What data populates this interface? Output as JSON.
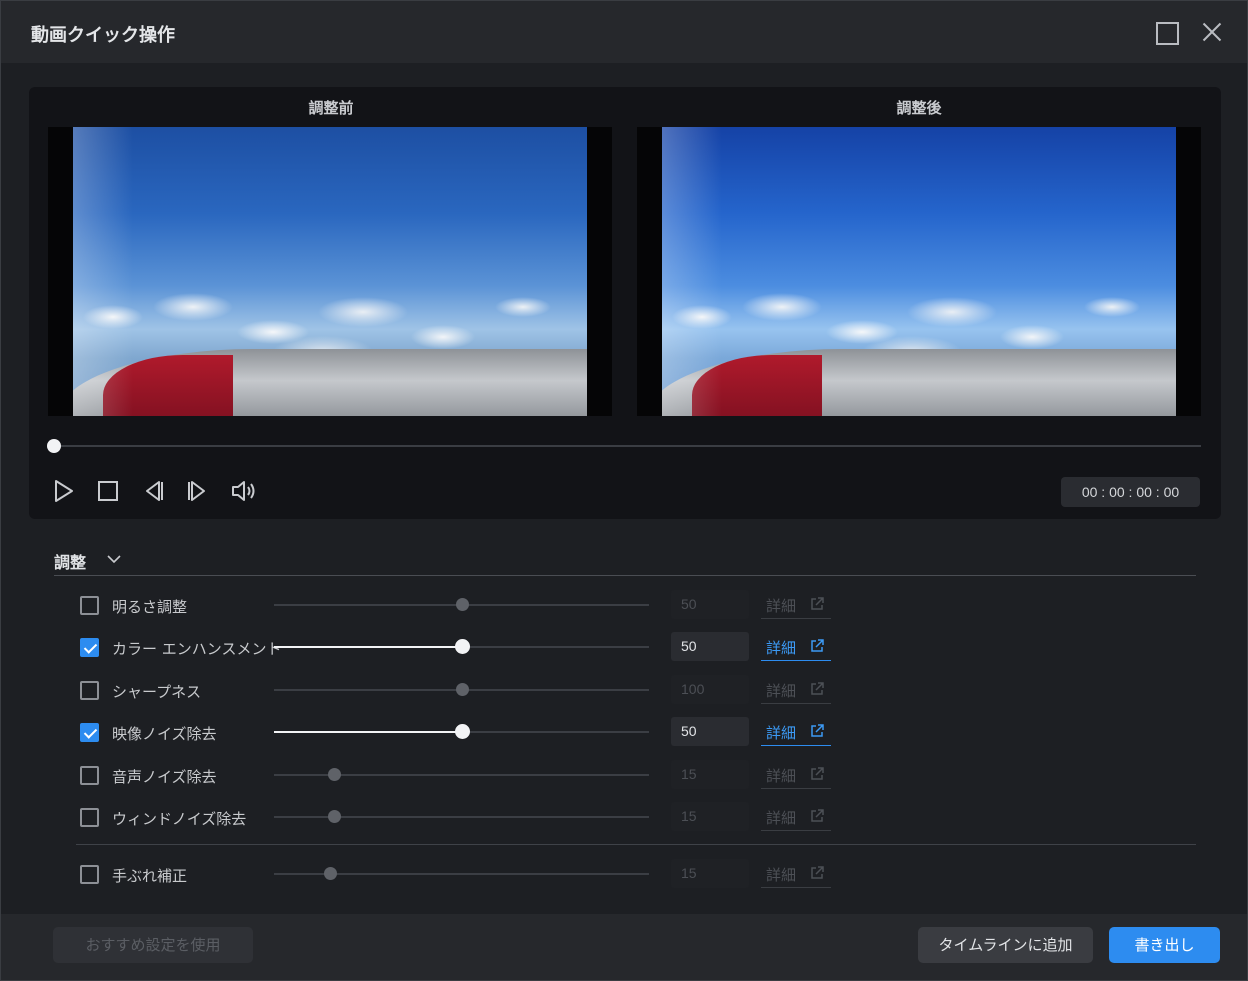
{
  "window": {
    "title": "動画クイック操作"
  },
  "preview": {
    "before_label": "調整前",
    "after_label": "調整後",
    "timecode": "00 : 00 : 00 : 00",
    "seek_position": 0
  },
  "adjust": {
    "section_title": "調整",
    "detail_label": "詳細",
    "items": [
      {
        "label": "明るさ調整",
        "checked": false,
        "value": "50",
        "level": 0.5
      },
      {
        "label": "カラー エンハンスメント",
        "checked": true,
        "value": "50",
        "level": 0.5
      },
      {
        "label": "シャープネス",
        "checked": false,
        "value": "100",
        "level": 0.5
      },
      {
        "label": "映像ノイズ除去",
        "checked": true,
        "value": "50",
        "level": 0.5
      },
      {
        "label": "音声ノイズ除去",
        "checked": false,
        "value": "15",
        "level": 0.16
      },
      {
        "label": "ウィンドノイズ除去",
        "checked": false,
        "value": "15",
        "level": 0.16
      },
      {
        "label": "手ぶれ補正",
        "checked": false,
        "value": "15",
        "level": 0.15
      }
    ]
  },
  "footer": {
    "recommend_label": "おすすめ設定を使用",
    "timeline_label": "タイムラインに追加",
    "export_label": "書き出し"
  },
  "colors": {
    "accent": "#2d8cf0",
    "background": "#1d1f23"
  },
  "icons": [
    "maximize-icon",
    "close-icon",
    "play-icon",
    "stop-icon",
    "prev-frame-icon",
    "next-frame-icon",
    "volume-icon",
    "chevron-down-icon",
    "external-link-icon"
  ]
}
